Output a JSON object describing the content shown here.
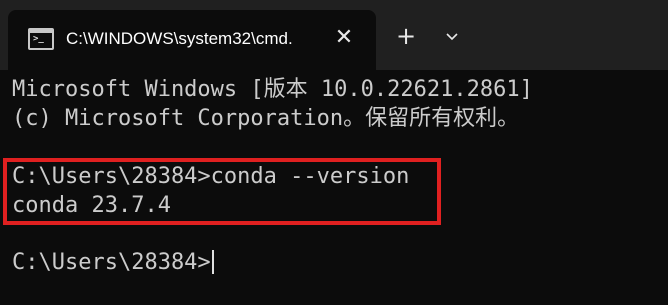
{
  "window": {
    "tab_title": "C:\\WINDOWS\\system32\\cmd.",
    "tab_icon": "cmd-icon",
    "close_glyph": "✕",
    "new_tab_glyph": "+",
    "dropdown_icon": "chevron-down-icon"
  },
  "terminal": {
    "lines": [
      "Microsoft Windows [版本 10.0.22621.2861]",
      "(c) Microsoft Corporation。保留所有权利。",
      "C:\\Users\\28384>conda --version",
      "conda 23.7.4",
      "C:\\Users\\28384>"
    ],
    "highlight_color": "#e02020"
  }
}
